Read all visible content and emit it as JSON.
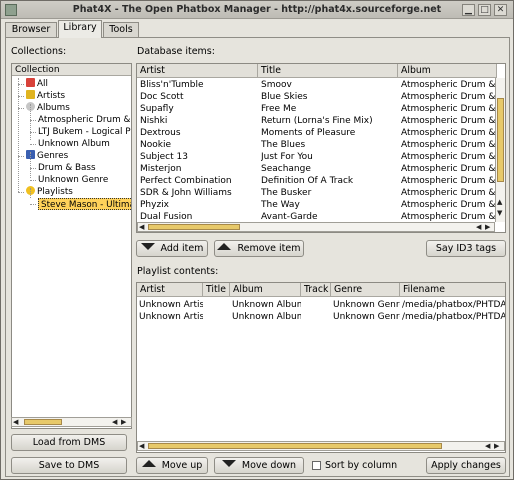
{
  "window": {
    "title": "Phat4X - The Open Phatbox Manager - http://phat4x.sourceforge.net"
  },
  "tabs": [
    "Browser",
    "Library",
    "Tools"
  ],
  "collections": {
    "label": "Collections:",
    "header": "Collection",
    "items": [
      {
        "label": "All",
        "indent": 1,
        "icon": "all-icon"
      },
      {
        "label": "Artists",
        "indent": 1,
        "icon": "star-icon"
      },
      {
        "label": "Albums",
        "indent": 1,
        "icon": "disc-icon"
      },
      {
        "label": "Atmospheric Drum & Bass",
        "indent": 2,
        "icon": ""
      },
      {
        "label": "LTJ Bukem - Logical Progression",
        "indent": 2,
        "icon": ""
      },
      {
        "label": "Unknown Album",
        "indent": 2,
        "icon": ""
      },
      {
        "label": "Genres",
        "indent": 1,
        "icon": "note-icon"
      },
      {
        "label": "Drum & Bass",
        "indent": 2,
        "icon": ""
      },
      {
        "label": "Unknown Genre",
        "indent": 2,
        "icon": ""
      },
      {
        "label": "Playlists",
        "indent": 1,
        "icon": "smiley-icon"
      },
      {
        "label": "Steve Mason - Ultimate",
        "indent": 2,
        "icon": "",
        "selected": true
      }
    ]
  },
  "database": {
    "label": "Database items:",
    "columns": [
      "Artist",
      "Title",
      "Album"
    ],
    "rows": [
      [
        "Bliss'n'Tumble",
        "Smoov",
        "Atmospheric Drum & Bass"
      ],
      [
        "Doc Scott",
        "Blue Skies",
        "Atmospheric Drum & Bass"
      ],
      [
        "Supafly",
        "Free Me",
        "Atmospheric Drum & Bass"
      ],
      [
        "Nishki",
        "Return (Lorna's Fine Mix)",
        "Atmospheric Drum & Bass"
      ],
      [
        "Dextrous",
        "Moments of Pleasure",
        "Atmospheric Drum & Bass"
      ],
      [
        "Nookie",
        "The Blues",
        "Atmospheric Drum & Bass"
      ],
      [
        "Subject 13",
        "Just For You",
        "Atmospheric Drum & Bass"
      ],
      [
        "Misterjon",
        "Seachange",
        "Atmospheric Drum & Bass"
      ],
      [
        "Perfect Combination",
        "Definition Of A Track",
        "Atmospheric Drum & Bass"
      ],
      [
        "SDR & John Williams",
        "The Busker",
        "Atmospheric Drum & Bass"
      ],
      [
        "Phyzix",
        "The Way",
        "Atmospheric Drum & Bass"
      ],
      [
        "Dual Fusion",
        "Avant-Garde",
        "Atmospheric Drum & Bass"
      ]
    ]
  },
  "buttons": {
    "add": "Add item",
    "remove": "Remove item",
    "say_id3": "Say ID3 tags",
    "load_dms": "Load from DMS",
    "save_dms": "Save to DMS",
    "move_up": "Move up",
    "move_down": "Move down",
    "sort_by_column": "Sort by column",
    "apply": "Apply changes"
  },
  "playlist": {
    "label": "Playlist contents:",
    "columns": [
      "Artist",
      "Title",
      "Album",
      "Track",
      "Genre",
      "Filename"
    ],
    "rows": [
      [
        "Unknown Artist",
        "",
        "Unknown Album",
        "",
        "Unknown Genre",
        "/media/phatbox/PHTDATA/MUSIC"
      ],
      [
        "Unknown Artist",
        "",
        "Unknown Album",
        "",
        "Unknown Genre",
        "/media/phatbox/PHTDATA/MUSIC"
      ]
    ]
  },
  "colors": {
    "accent": "#ffd25a",
    "scroll_thumb": "#e7c96a"
  }
}
